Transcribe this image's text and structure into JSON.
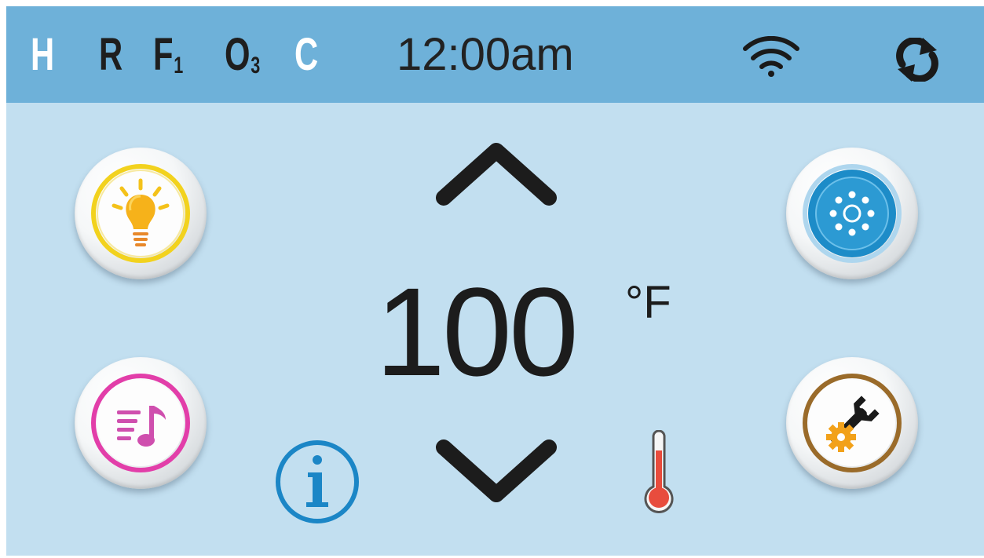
{
  "status_bar": {
    "indicators": [
      {
        "letter": "H",
        "sub": "",
        "active": true
      },
      {
        "letter": "R",
        "sub": "",
        "active": false
      },
      {
        "letter": "F",
        "sub": "1",
        "active": false
      },
      {
        "letter": "O",
        "sub": "3",
        "active": false
      },
      {
        "letter": "C",
        "sub": "",
        "active": true
      }
    ],
    "clock": "12:00am",
    "icons": [
      "wifi-icon",
      "sync-icon"
    ]
  },
  "temperature": {
    "value": "100",
    "unit": "°F"
  },
  "buttons": {
    "left": [
      "light-icon",
      "music-icon"
    ],
    "right": [
      "jets-icon",
      "settings-icon"
    ],
    "bottom": [
      "info-icon",
      "thermometer-icon"
    ]
  },
  "colors": {
    "status_bar": "#6eb1d9",
    "background": "#c2dff0",
    "indicator_active": "#ffffff",
    "indicator_inactive": "#1e1e1e",
    "light_ring": "#f2d21e",
    "music_ring": "#e23ea9",
    "jets_ring": "#1d8cc8",
    "settings_ring": "#9a6b2a",
    "info": "#1b86c6",
    "thermometer": "#e84c3d"
  }
}
